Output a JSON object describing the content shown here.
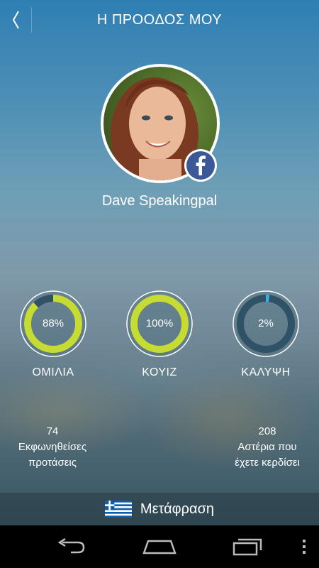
{
  "header": {
    "title": "Η ΠΡΟΟΔΟΣ ΜΟΥ"
  },
  "profile": {
    "name": "Dave Speakingpal"
  },
  "progress": [
    {
      "label": "ΟΜΙΛΙΑ",
      "value": 0.88,
      "display": "88%"
    },
    {
      "label": "ΚΟΥΙΖ",
      "value": 1.0,
      "display": "100%"
    },
    {
      "label": "ΚΑΛΥΨΗ",
      "value": 0.02,
      "display": "2%"
    }
  ],
  "stats": {
    "spoken": {
      "count": "74",
      "line1": "Εκφωνηθείσες",
      "line2": "προτάσεις"
    },
    "stars": {
      "count": "208",
      "line1": "Αστέρια που",
      "line2": "έχετε κερδίσει"
    }
  },
  "translate": {
    "label": "Μετάφραση"
  },
  "colors": {
    "ring_fill": "#c6dc32",
    "ring_track": "#2f5266",
    "coverage_fill": "#3ab0e6",
    "facebook": "#3b5998"
  },
  "icons": {
    "back": "chevron-left-icon",
    "facebook": "facebook-icon",
    "flag": "greek-flag-icon",
    "nav_back": "back-arrow-icon",
    "nav_home": "home-icon",
    "nav_recent": "recent-apps-icon",
    "nav_menu": "menu-dots-icon"
  }
}
